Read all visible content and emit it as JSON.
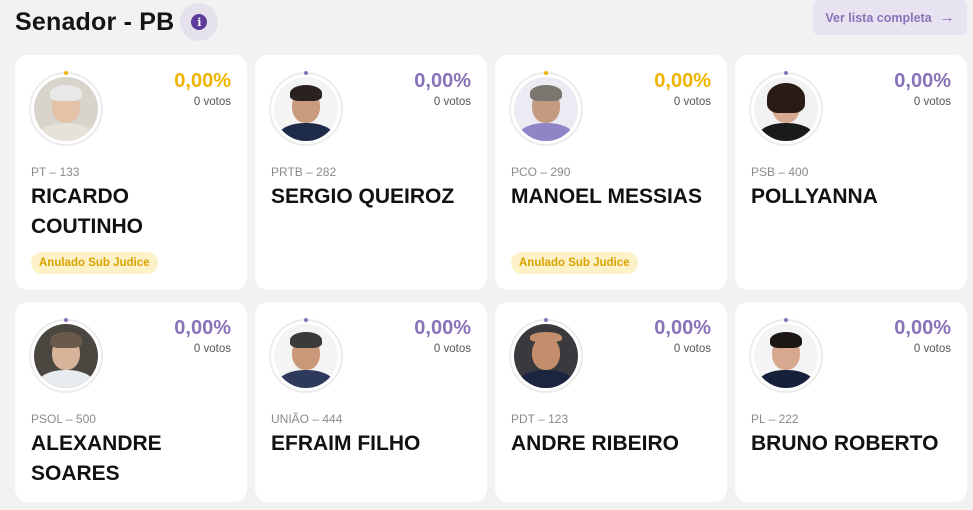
{
  "header": {
    "title": "Senador - PB",
    "list_button_label": "Ver lista completa",
    "list_button_arrow": "→"
  },
  "colors": {
    "accent_purple": "#8a72b8",
    "accent_gold": "#f0b400",
    "badge_bg": "#fdf1c8"
  },
  "candidates": [
    {
      "party": "PT – 133",
      "name_line1": "RICARDO",
      "name_line2": "COUTINHO",
      "percent": "0,00%",
      "votes": "0 votos",
      "badge": "Anulado Sub Judice",
      "highlight": "gold"
    },
    {
      "party": "PRTB – 282",
      "name_line1": "SERGIO QUEIROZ",
      "name_line2": "",
      "percent": "0,00%",
      "votes": "0 votos",
      "badge": "",
      "highlight": "purple"
    },
    {
      "party": "PCO – 290",
      "name_line1": "MANOEL MESSIAS",
      "name_line2": "",
      "percent": "0,00%",
      "votes": "0 votos",
      "badge": "Anulado Sub Judice",
      "highlight": "gold"
    },
    {
      "party": "PSB – 400",
      "name_line1": "POLLYANNA",
      "name_line2": "",
      "percent": "0,00%",
      "votes": "0 votos",
      "badge": "",
      "highlight": "purple"
    },
    {
      "party": "PSOL – 500",
      "name_line1": "ALEXANDRE",
      "name_line2": "SOARES",
      "percent": "0,00%",
      "votes": "0 votos",
      "badge": "",
      "highlight": "purple"
    },
    {
      "party": "UNIÃO – 444",
      "name_line1": "EFRAIM FILHO",
      "name_line2": "",
      "percent": "0,00%",
      "votes": "0 votos",
      "badge": "",
      "highlight": "purple"
    },
    {
      "party": "PDT – 123",
      "name_line1": "ANDRE RIBEIRO",
      "name_line2": "",
      "percent": "0,00%",
      "votes": "0 votos",
      "badge": "",
      "highlight": "purple"
    },
    {
      "party": "PL – 222",
      "name_line1": "BRUNO ROBERTO",
      "name_line2": "",
      "percent": "0,00%",
      "votes": "0 votos",
      "badge": "",
      "highlight": "purple"
    }
  ]
}
